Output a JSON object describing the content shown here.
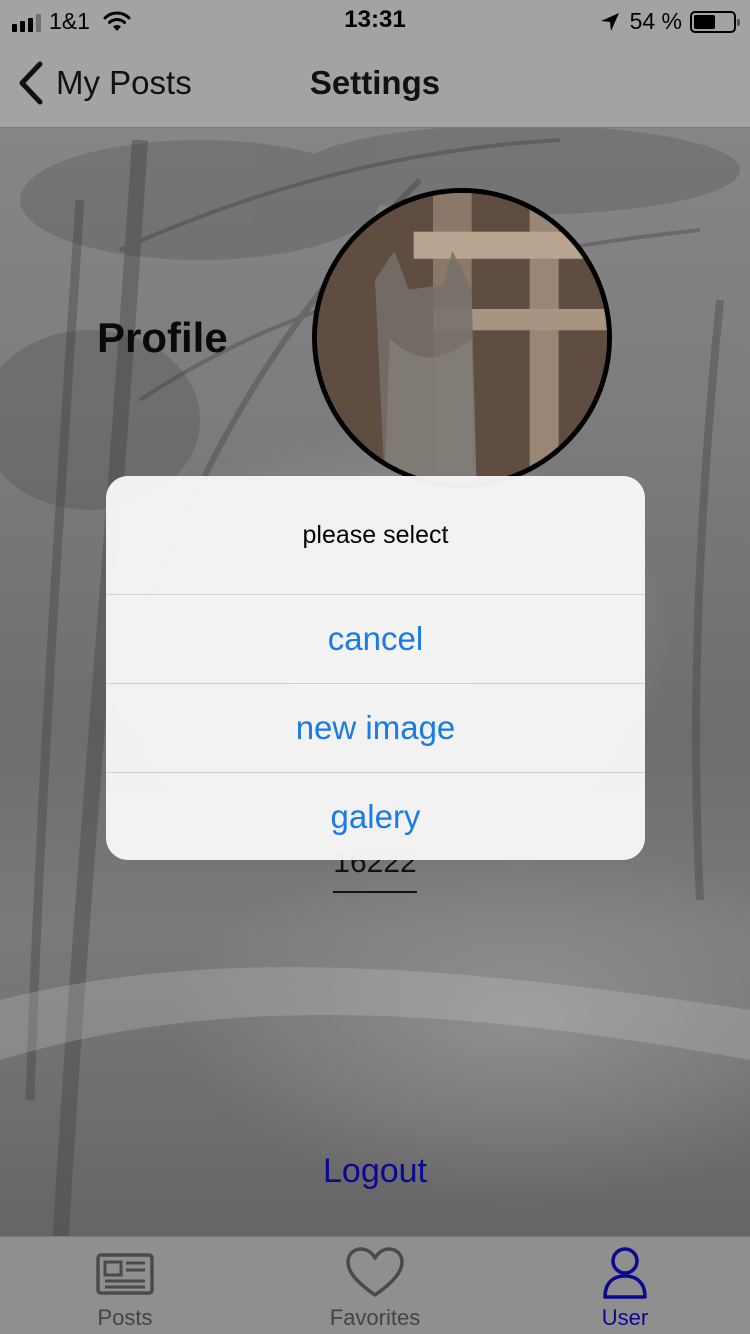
{
  "status_bar": {
    "carrier": "1&1",
    "time": "13:31",
    "battery_text": "54 %",
    "battery_level": 0.54
  },
  "nav": {
    "back_label": "My Posts",
    "title": "Settings"
  },
  "profile": {
    "title": "Profile",
    "field_value": "16222"
  },
  "alert": {
    "message": "please select",
    "actions": [
      "cancel",
      "new image",
      "galery"
    ]
  },
  "logout_label": "Logout",
  "tabs": [
    {
      "label": "Posts",
      "icon": "newspaper-icon",
      "active": false
    },
    {
      "label": "Favorites",
      "icon": "heart-icon",
      "active": false
    },
    {
      "label": "User",
      "icon": "user-icon",
      "active": true
    }
  ],
  "colors": {
    "accent": "#1a7ae8",
    "active_tab": "#0a0a90"
  }
}
